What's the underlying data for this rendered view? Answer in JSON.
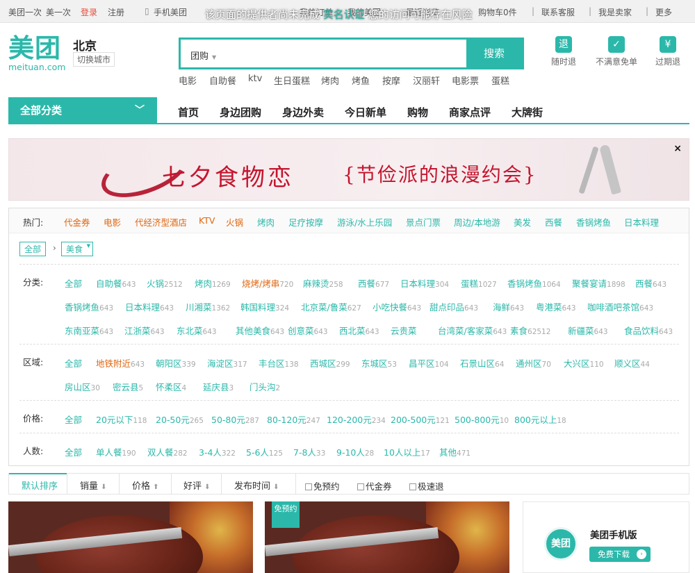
{
  "topbar": {
    "links": [
      "美团一次",
      "美一次",
      "登录",
      "注册",
      "手机美团",
      "我的订单",
      "我的美团",
      "最近浏览",
      "购物车0件",
      "联系客服",
      "我是卖家",
      "更多"
    ],
    "warning_prefix": "该页面的提供者尚未完成",
    "warning_link": "实名认证",
    "warning_suffix": "您的访问可能存在风险"
  },
  "logo": {
    "cn": "美团",
    "en": "meituan.com"
  },
  "city": {
    "name": "北京",
    "switch": "切换城市"
  },
  "search": {
    "category": "团购",
    "placeholder": "",
    "button": "搜索"
  },
  "hotwords": [
    "电影",
    "自助餐",
    "ktv",
    "生日蛋糕",
    "烤肉",
    "烤鱼",
    "按摩",
    "汉丽轩",
    "电影票",
    "蛋糕"
  ],
  "promises": [
    {
      "icon": "退",
      "label": "随时退"
    },
    {
      "icon": "✓",
      "label": "不满意免单"
    },
    {
      "icon": "¥",
      "label": "过期退"
    }
  ],
  "nav": {
    "all_categories": "全部分类",
    "items": [
      "首页",
      "身边团购",
      "身边外卖",
      "今日新单",
      "购物",
      "商家点评",
      "大牌街"
    ]
  },
  "banner": {
    "title": "七夕食物恋",
    "subtitle": "{节俭派的浪漫约会}",
    "close": "×"
  },
  "filter": {
    "hot_label": "热门:",
    "hot_items": [
      "代金券",
      "电影",
      "代经济型酒店",
      "KTV",
      "火锅",
      "烤肉",
      "足疗按摩",
      "游泳/水上乐园",
      "景点门票",
      "周边/本地游",
      "美发",
      "西餐",
      "香锅烤鱼",
      "日本料理"
    ],
    "breadcrumb": [
      "全部",
      "美食"
    ],
    "category_label": "分类:",
    "categories": [
      {
        "name": "全部",
        "count": ""
      },
      {
        "name": "自助餐",
        "count": "643"
      },
      {
        "name": "火锅",
        "count": "2512"
      },
      {
        "name": "烤肉",
        "count": "1269"
      },
      {
        "name": "烧烤/烤串",
        "count": "720"
      },
      {
        "name": "麻辣烫",
        "count": "258"
      },
      {
        "name": "西餐",
        "count": "677"
      },
      {
        "name": "日本料理",
        "count": "304"
      },
      {
        "name": "蛋糕",
        "count": "1027"
      },
      {
        "name": "香锅烤鱼",
        "count": "1064"
      },
      {
        "name": "聚餐宴请",
        "count": "1898"
      },
      {
        "name": "西餐",
        "count": "643"
      },
      {
        "name": "香锅烤鱼",
        "count": "643"
      },
      {
        "name": "日本料理",
        "count": "643"
      },
      {
        "name": "川湘菜",
        "count": "1362"
      },
      {
        "name": "韩国料理",
        "count": "324"
      },
      {
        "name": "北京菜/鲁菜",
        "count": "627"
      },
      {
        "name": "小吃快餐",
        "count": "643"
      },
      {
        "name": "甜点印品",
        "count": "643"
      },
      {
        "name": "海鲜",
        "count": "643"
      },
      {
        "name": "粤港菜",
        "count": "643"
      },
      {
        "name": "咖啡酒吧茶馆",
        "count": "643"
      },
      {
        "name": "东南亚菜",
        "count": "643"
      },
      {
        "name": "江浙菜",
        "count": "643"
      },
      {
        "name": "东北菜",
        "count": "643"
      },
      {
        "name": "其他美食",
        "count": "643"
      },
      {
        "name": "创意菜",
        "count": "643"
      },
      {
        "name": "西北菜",
        "count": "643"
      },
      {
        "name": "云贵菜",
        "count": ""
      },
      {
        "name": "台湾菜/客家菜",
        "count": "643"
      },
      {
        "name": "素食",
        "count": "62512"
      },
      {
        "name": "新疆菜",
        "count": "643"
      },
      {
        "name": "食品饮料",
        "count": "643"
      }
    ],
    "area_label": "区域:",
    "areas": [
      {
        "name": "全部",
        "count": ""
      },
      {
        "name": "地铁附近",
        "count": "643"
      },
      {
        "name": "朝阳区",
        "count": "339"
      },
      {
        "name": "海淀区",
        "count": "317"
      },
      {
        "name": "丰台区",
        "count": "138"
      },
      {
        "name": "西城区",
        "count": "299"
      },
      {
        "name": "东城区",
        "count": "53"
      },
      {
        "name": "昌平区",
        "count": "104"
      },
      {
        "name": "石景山区",
        "count": "64"
      },
      {
        "name": "通州区",
        "count": "70"
      },
      {
        "name": "大兴区",
        "count": "110"
      },
      {
        "name": "顺义区",
        "count": "44"
      },
      {
        "name": "房山区",
        "count": "30"
      },
      {
        "name": "密云县",
        "count": "5"
      },
      {
        "name": "怀柔区",
        "count": "4"
      },
      {
        "name": "延庆县",
        "count": "3"
      },
      {
        "name": "门头沟",
        "count": "2"
      }
    ],
    "price_label": "价格:",
    "prices": [
      {
        "name": "全部",
        "count": ""
      },
      {
        "name": "20元以下",
        "count": "118"
      },
      {
        "name": "20-50元",
        "count": "265"
      },
      {
        "name": "50-80元",
        "count": "287"
      },
      {
        "name": "80-120元",
        "count": "247"
      },
      {
        "name": "120-200元",
        "count": "234"
      },
      {
        "name": "200-500元",
        "count": "121"
      },
      {
        "name": "500-800元",
        "count": "10"
      },
      {
        "name": "800元以上",
        "count": "18"
      }
    ],
    "people_label": "人数:",
    "people": [
      {
        "name": "全部",
        "count": ""
      },
      {
        "name": "单人餐",
        "count": "190"
      },
      {
        "name": "双人餐",
        "count": "282"
      },
      {
        "name": "3-4人",
        "count": "322"
      },
      {
        "name": "5-6人",
        "count": "125"
      },
      {
        "name": "7-8人",
        "count": "33"
      },
      {
        "name": "9-10人",
        "count": "28"
      },
      {
        "name": "10人以上",
        "count": "17"
      },
      {
        "name": "其他",
        "count": "471"
      }
    ]
  },
  "sort": {
    "items": [
      "默认排序",
      "销量",
      "价格",
      "好评",
      "发布时间"
    ],
    "checks": [
      "免预约",
      "代金券",
      "极速退"
    ]
  },
  "cards": [
    {
      "badge": ""
    },
    {
      "badge": "免预约"
    }
  ],
  "app": {
    "icon": "美团",
    "title": "美团手机版",
    "button": "免费下载"
  },
  "colors": {
    "brand": "#2bb8aa",
    "highlight": "#e06610",
    "login": "#e74c3c"
  }
}
